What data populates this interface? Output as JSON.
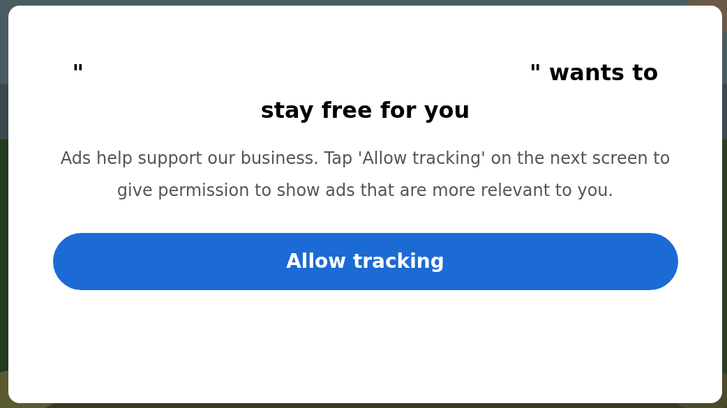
{
  "dialog": {
    "title_open_quote": "\"",
    "title_line_1": "\" wants to",
    "title_line_2": "stay free for you",
    "message": "Ads help support our business. Tap 'Allow tracking' on the next screen to give permission to show ads that are more relevant to you.",
    "button": "Allow tracking"
  }
}
